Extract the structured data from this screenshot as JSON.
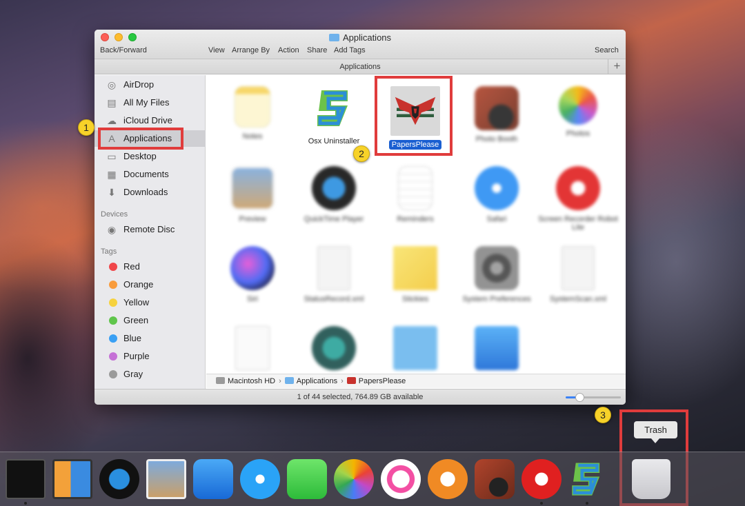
{
  "window": {
    "title": "Applications",
    "toolbar": {
      "back_forward": "Back/Forward",
      "view": "View",
      "arrange_by": "Arrange By",
      "action": "Action",
      "share": "Share",
      "add_tags": "Add Tags",
      "search": "Search"
    },
    "tab_title": "Applications",
    "plus": "+"
  },
  "sidebar": {
    "favorites": [
      {
        "label": "AirDrop",
        "icon": "airdrop-icon"
      },
      {
        "label": "All My Files",
        "icon": "all-files-icon"
      },
      {
        "label": "iCloud Drive",
        "icon": "cloud-icon"
      },
      {
        "label": "Applications",
        "icon": "applications-icon",
        "selected": true
      },
      {
        "label": "Desktop",
        "icon": "desktop-icon"
      },
      {
        "label": "Documents",
        "icon": "documents-icon"
      },
      {
        "label": "Downloads",
        "icon": "downloads-icon"
      }
    ],
    "devices_header": "Devices",
    "devices": [
      {
        "label": "Remote Disc",
        "icon": "disc-icon"
      }
    ],
    "tags_header": "Tags",
    "tags": [
      {
        "label": "Red",
        "color": "#f0464a"
      },
      {
        "label": "Orange",
        "color": "#f99c3c"
      },
      {
        "label": "Yellow",
        "color": "#f6d23e"
      },
      {
        "label": "Green",
        "color": "#5fc54b"
      },
      {
        "label": "Blue",
        "color": "#3aa0f4"
      },
      {
        "label": "Purple",
        "color": "#c571d6"
      },
      {
        "label": "Gray",
        "color": "#9a9a9a"
      }
    ]
  },
  "apps": [
    {
      "label": "Notes"
    },
    {
      "label": "Osx Uninstaller"
    },
    {
      "label": "PapersPlease",
      "selected": true
    },
    {
      "label": "Photo Booth"
    },
    {
      "label": "Photos"
    },
    {
      "label": "Preview"
    },
    {
      "label": "QuickTime Player"
    },
    {
      "label": "Reminders"
    },
    {
      "label": "Safari"
    },
    {
      "label": "Screen Recorder Robot Lite"
    },
    {
      "label": "Siri"
    },
    {
      "label": "StatusRecord.xml"
    },
    {
      "label": "Stickies"
    },
    {
      "label": "System Preferences"
    },
    {
      "label": "SystemScan.xml"
    }
  ],
  "pathbar": {
    "items": [
      "Macintosh HD",
      "Applications",
      "PapersPlease"
    ],
    "separator": "›"
  },
  "status": {
    "text": "1 of 44 selected, 764.89 GB available",
    "icon_size_fraction": 0.25
  },
  "callouts": [
    "1",
    "2",
    "3"
  ],
  "dock": {
    "tooltip": "Trash",
    "icons": [
      "activity-monitor-icon",
      "screen-sharing-icon",
      "quicktime-icon",
      "preview-icon",
      "xcode-icon",
      "messages-icon",
      "facetime-icon",
      "photos-icon",
      "itunes-icon",
      "ibooks-icon",
      "photo-booth-icon",
      "screen-recorder-icon",
      "osx-uninstaller-icon",
      "trash-icon"
    ]
  }
}
